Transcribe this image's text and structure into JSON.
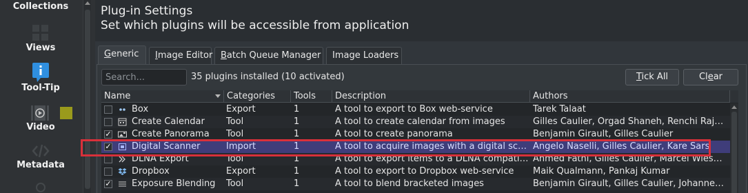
{
  "sidebar": {
    "items": [
      {
        "label": "Collections",
        "icon": "collections-icon"
      },
      {
        "label": "Views",
        "icon": "views-icon"
      },
      {
        "label": "Tool-Tip",
        "icon": "info-icon"
      },
      {
        "label": "Video",
        "icon": "video-icon"
      },
      {
        "label": "Metadata",
        "icon": "metadata-icon"
      }
    ]
  },
  "header": {
    "title": "Plug-in Settings",
    "subtitle": "Set which plugins will be accessible from application"
  },
  "tabs": [
    {
      "label": "Generic",
      "mnemonic": "G",
      "rest": "eneric",
      "active": true
    },
    {
      "label": "Image Editor",
      "mnemonic": "I",
      "rest": "mage Editor"
    },
    {
      "label": "Batch Queue Manager",
      "mnemonic": "B",
      "rest": "atch Queue Manager"
    },
    {
      "label": "Image Loaders",
      "mnemonic": "",
      "rest": "Image Loaders"
    }
  ],
  "toolbar": {
    "search_placeholder": "Search...",
    "count_text": "35 plugins installed  (10 activated)",
    "tick_all_pre": "",
    "tick_all_mn": "T",
    "tick_all_post": "ick All",
    "clear_pre": "Cl",
    "clear_mn": "e",
    "clear_post": "ar"
  },
  "table": {
    "columns": [
      "Name",
      "Categories",
      "Tools",
      "Description",
      "Authors"
    ],
    "rows": [
      {
        "name": "Box",
        "category": "Export",
        "tools": "1",
        "description": "A tool to export to Box web-service",
        "authors": "Tarek Talaat",
        "checked": false,
        "icon": "box-icon"
      },
      {
        "name": "Create Calendar",
        "category": "Tool",
        "tools": "1",
        "description": "A tool to create calendar from images",
        "authors": "Gilles Caulier, Orgad Shaneh, Renchi Raju, T...",
        "checked": false,
        "icon": "calendar-icon"
      },
      {
        "name": "Create Panorama",
        "category": "Tool",
        "tools": "1",
        "description": "A tool to create panorama",
        "authors": "Benjamin Girault, Gilles Caulier",
        "checked": true,
        "icon": "panorama-icon"
      },
      {
        "name": "Digital Scanner",
        "category": "Import",
        "tools": "1",
        "description": "A tool to acquire images with a digital scanner",
        "authors": "Angelo Naselli, Gilles Caulier, Kare Sars",
        "checked": true,
        "icon": "scanner-icon",
        "selected": true
      },
      {
        "name": "DLNA Export",
        "category": "Tool",
        "tools": "1",
        "description": "A tool to export items to a DLNA compatible ...",
        "authors": "Ahmed Fathi, Gilles Caulier, Marcel Wiesweg...",
        "checked": false,
        "icon": "dlna-icon"
      },
      {
        "name": "Dropbox",
        "category": "Export",
        "tools": "1",
        "description": "A tool to export to Dropbox web-service",
        "authors": "Maik Qualmann, Pankaj Kumar",
        "checked": false,
        "icon": "dropbox-icon"
      },
      {
        "name": "Exposure Blending",
        "category": "Tool",
        "tools": "1",
        "description": "A tool to blend bracketed images",
        "authors": "Benjamin Girault, Gilles Caulier, Johannes W...",
        "checked": true,
        "icon": "exposure-blending-icon"
      }
    ]
  },
  "colors": {
    "selection": "#3f3d7a",
    "highlight_border": "#d9303a",
    "info_icon": "#2f8fe0",
    "video_swatch": "#9a9a1c"
  }
}
